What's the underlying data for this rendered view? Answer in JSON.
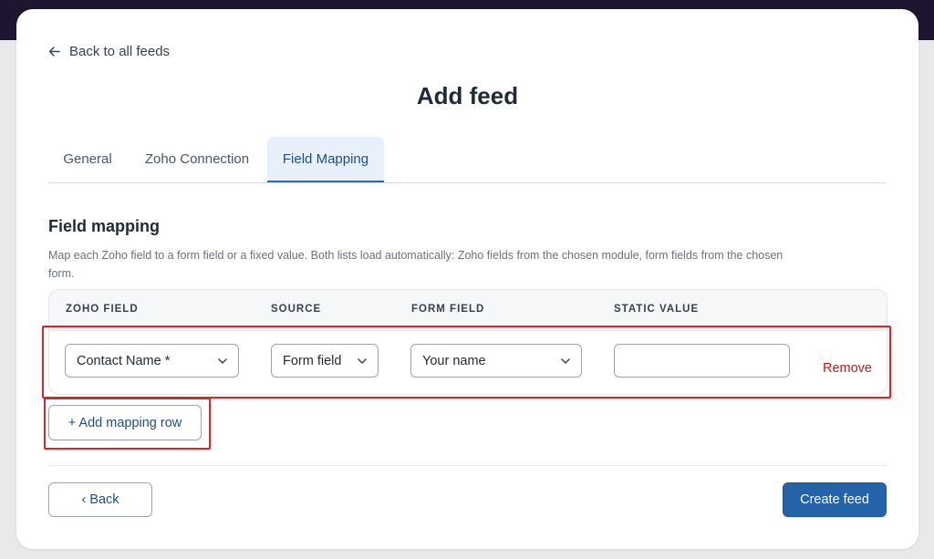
{
  "header": {
    "back_label": "Back to all feeds",
    "title": "Add feed"
  },
  "tabs": [
    {
      "label": "General",
      "active": false
    },
    {
      "label": "Zoho Connection",
      "active": false
    },
    {
      "label": "Field Mapping",
      "active": true
    }
  ],
  "section": {
    "title": "Field mapping",
    "description": "Map each Zoho field to a form field or a fixed value. Both lists load automatically: Zoho fields from the chosen module, form fields from the chosen form."
  },
  "table": {
    "columns": [
      "ZOHO FIELD",
      "SOURCE",
      "FORM FIELD",
      "STATIC VALUE"
    ],
    "rows": [
      {
        "zoho_field": "Contact Name *",
        "source": "Form field",
        "form_field": "Your name",
        "static_value": "",
        "remove_label": "Remove"
      }
    ]
  },
  "actions": {
    "add_row_label": "+ Add mapping row",
    "back_label": "‹ Back",
    "create_label": "Create feed"
  },
  "colors": {
    "accent": "#2563a8",
    "danger": "#b42318",
    "highlight": "#d9262c",
    "active_tab_bg": "#e8f1fb"
  },
  "icons": {
    "back": "arrow-left-icon",
    "dropdown": "chevron-down-icon"
  }
}
